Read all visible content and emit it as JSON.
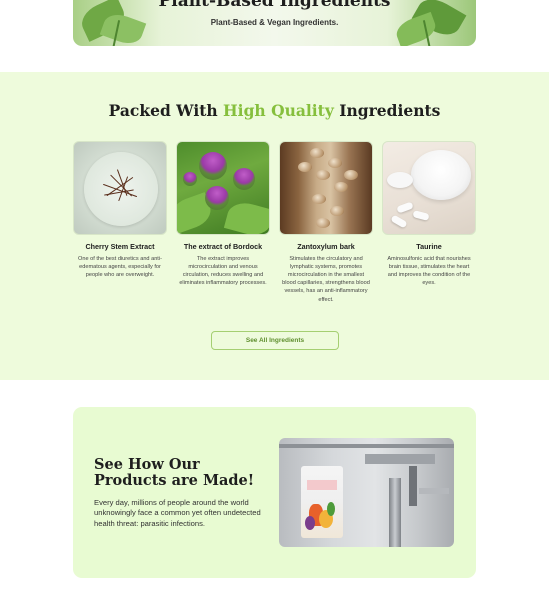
{
  "hero": {
    "title": "Plant-Based Ingredients",
    "subtitle": "Plant-Based & Vegan Ingredients."
  },
  "ingredients": {
    "title_start": "Packed With ",
    "title_highlight": "High Quality",
    "title_end": " Ingredients",
    "highlight_color": "#86bf3d",
    "items": [
      {
        "name": "Cherry Stem Extract",
        "description": "One of the best diuretics and anti-edematous agents, especially for people who are overweight.",
        "image": "cherry-stems-photo"
      },
      {
        "name": "The extract of Bordock",
        "description": "The extract improves microcirculation and venous circulation, reduces swelling and eliminates inflammatory processes.",
        "image": "burdock-flower-photo"
      },
      {
        "name": "Zantoxylum bark",
        "description": "Stimulates the circulatory and lymphatic systems, promotes microcirculation in the smallest blood capillaries, strengthens blood vessels, has an anti-inflammatory effect.",
        "image": "zanthoxylum-bark-photo"
      },
      {
        "name": "Taurine",
        "description": "Aminosulfonic acid that nourishes brain tissue, stimulates the heart and improves the condition of the eyes.",
        "image": "taurine-powder-photo"
      }
    ],
    "button_label": "See All Ingredients"
  },
  "made": {
    "title": "See How Our Products are Made!",
    "text": "Every day, millions of people around the world unknowingly face a common yet often undetected health threat: parasitic infections.",
    "image": "production-line-photo"
  },
  "colors": {
    "section_bg": "#eefbdc",
    "card_bg": "#e8fbd2",
    "accent": "#86bf3d"
  }
}
